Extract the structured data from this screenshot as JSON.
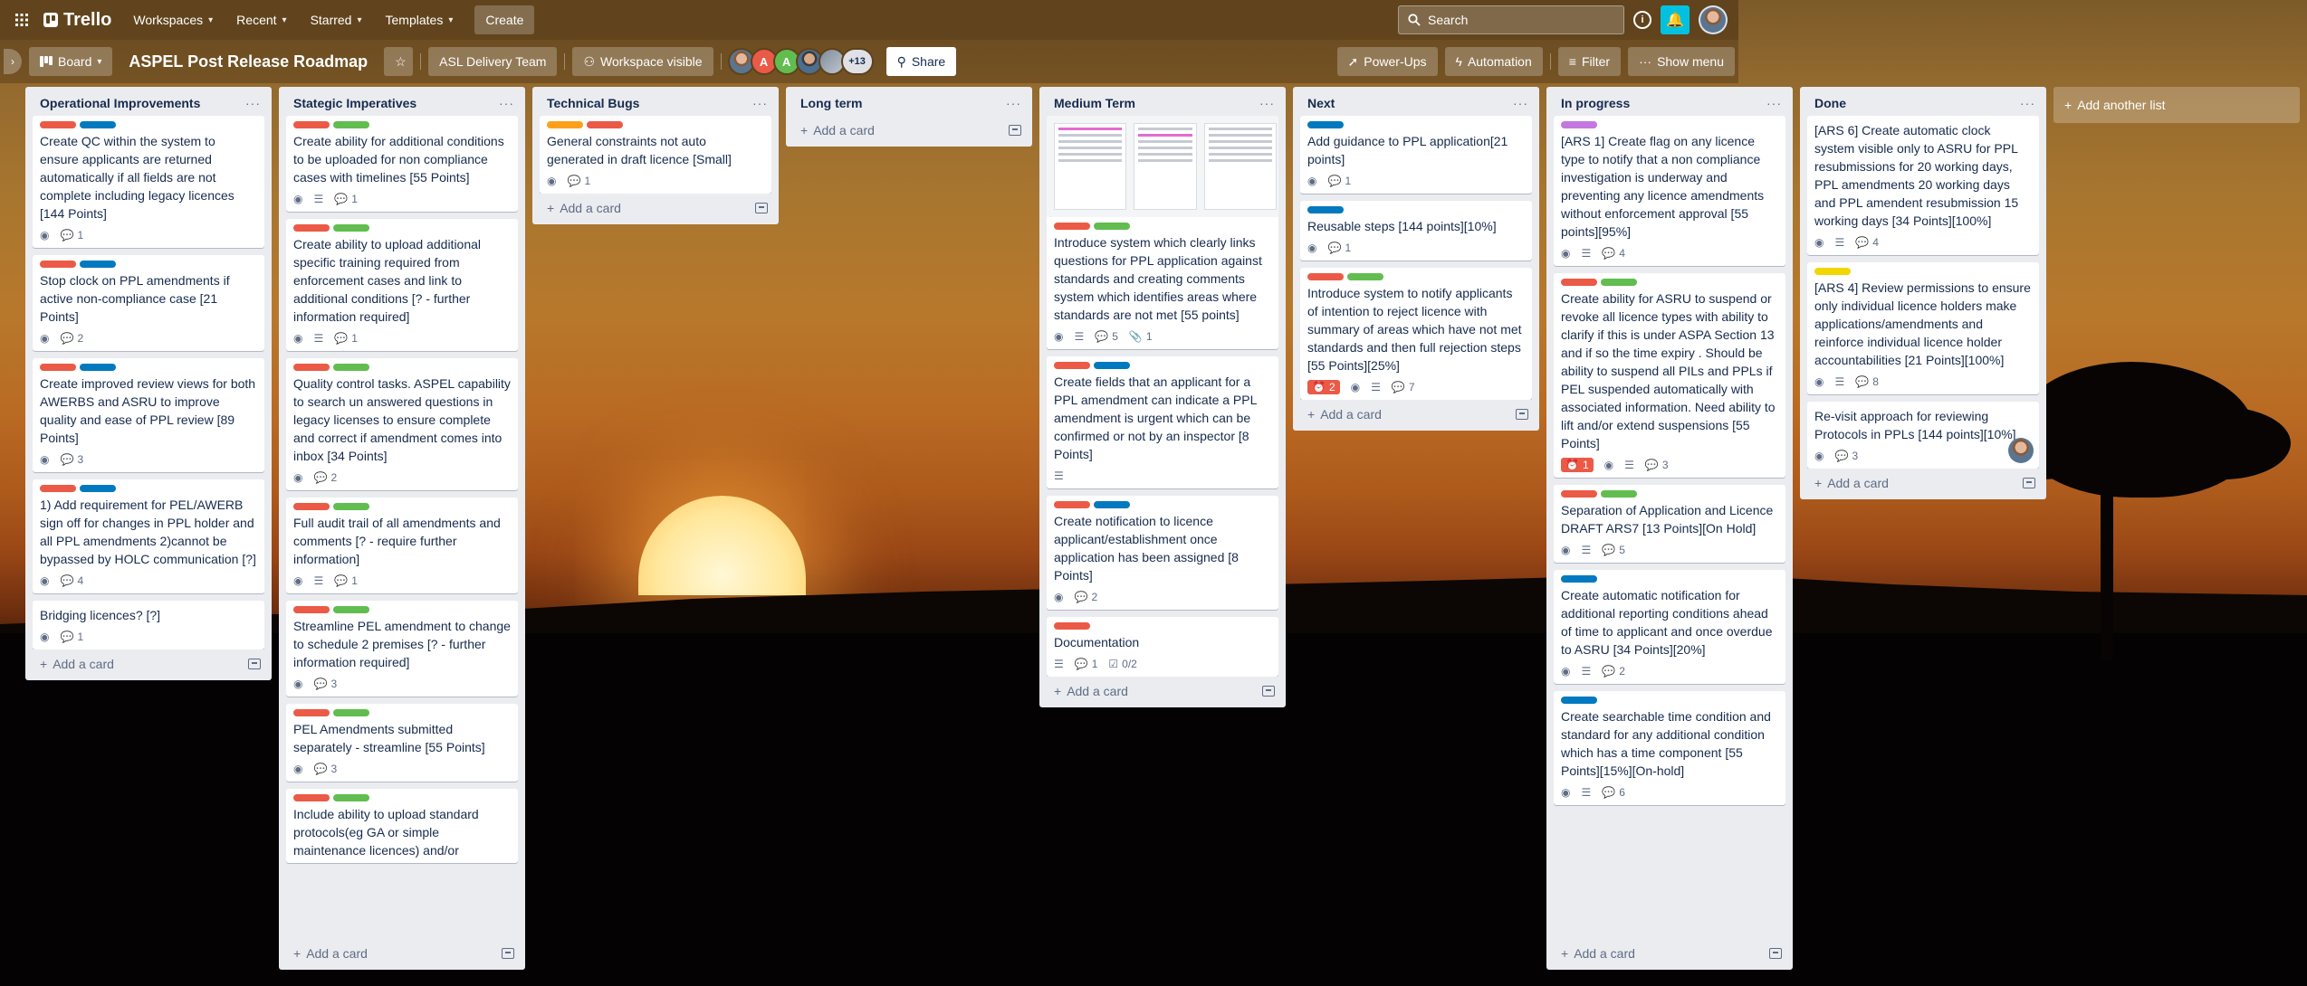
{
  "topbar": {
    "logo": "Trello",
    "nav": [
      {
        "label": "Workspaces"
      },
      {
        "label": "Recent"
      },
      {
        "label": "Starred"
      },
      {
        "label": "Templates"
      }
    ],
    "create_label": "Create",
    "search_placeholder": "Search",
    "info_glyph": "i",
    "bell_glyph": "🔔"
  },
  "board": {
    "view_label": "Board",
    "title": "ASPEL Post Release Roadmap",
    "star_glyph": "☆",
    "workspace_label": "ASL Delivery Team",
    "visibility_label": "Workspace visible",
    "members": [
      {
        "initial": "",
        "color": "#6b7f94"
      },
      {
        "initial": "A",
        "color": "#eb5a46"
      },
      {
        "initial": "A",
        "color": "#61bd4f"
      },
      {
        "initial": "",
        "color": "#4b6f8f"
      },
      {
        "initial": "",
        "color": "#7d8b99"
      }
    ],
    "more_members": "+13",
    "share_label": "Share",
    "powerups_label": "Power-Ups",
    "automation_label": "Automation",
    "filter_label": "Filter",
    "menu_label": "Show menu"
  },
  "colors": {
    "red": "#eb5a46",
    "green": "#61bd4f",
    "blue": "#0079bf",
    "orange": "#ff9f1a",
    "yellow": "#f2d600",
    "purple": "#c377e0"
  },
  "lists": [
    {
      "title": "Operational Improvements",
      "add_label": "Add a card",
      "cards": [
        {
          "labels": [
            "red",
            "blue"
          ],
          "title": "Create QC within the system to ensure applicants are returned automatically if all fields are not complete including legacy licences [144 Points]",
          "badges": {
            "watch": true,
            "comments": "1"
          }
        },
        {
          "labels": [
            "red",
            "blue"
          ],
          "title": "Stop clock on PPL amendments if active non-compliance case [21 Points]",
          "badges": {
            "watch": true,
            "comments": "2"
          }
        },
        {
          "labels": [
            "red",
            "blue"
          ],
          "title": "Create improved review views for both AWERBS and ASRU to improve quality and ease of PPL review [89 Points]",
          "badges": {
            "watch": true,
            "comments": "3"
          }
        },
        {
          "labels": [
            "red",
            "blue"
          ],
          "title": "1) Add requirement for PEL/AWERB sign off for changes in PPL holder and all PPL amendments 2)cannot be bypassed by HOLC communication [?]",
          "badges": {
            "watch": true,
            "comments": "4"
          }
        },
        {
          "labels": [],
          "title": "Bridging licences? [?]",
          "badges": {
            "watch": true,
            "comments": "1"
          }
        }
      ]
    },
    {
      "title": "Stategic Imperatives",
      "add_label": "Add a card",
      "cards": [
        {
          "labels": [
            "red",
            "green"
          ],
          "title": "Create ability for additional conditions to be uploaded for non compliance cases with timelines [55 Points]",
          "badges": {
            "watch": true,
            "desc": true,
            "comments": "1"
          }
        },
        {
          "labels": [
            "red",
            "green"
          ],
          "title": "Create ability to upload additional specific training required from enforcement cases and link to additional conditions [? - further information required]",
          "badges": {
            "watch": true,
            "desc": true,
            "comments": "1"
          }
        },
        {
          "labels": [
            "red",
            "green"
          ],
          "title": "Quality control tasks. ASPEL capability to search un answered questions in legacy licenses to ensure complete and correct if amendment comes into inbox [34 Points]",
          "badges": {
            "watch": true,
            "comments": "2"
          }
        },
        {
          "labels": [
            "red",
            "green"
          ],
          "title": "Full audit trail of all amendments and comments [? - require further information]",
          "badges": {
            "watch": true,
            "desc": true,
            "comments": "1"
          }
        },
        {
          "labels": [
            "red",
            "green"
          ],
          "title": "Streamline PEL amendment to change to schedule 2 premises [? - further information required]",
          "badges": {
            "watch": true,
            "comments": "3"
          }
        },
        {
          "labels": [
            "red",
            "green"
          ],
          "title": "PEL Amendments submitted separately - streamline [55 Points]",
          "badges": {
            "watch": true,
            "comments": "3"
          }
        },
        {
          "labels": [
            "red",
            "green"
          ],
          "title": "Include ability to upload standard protocols(eg GA or simple maintenance licences) and/or",
          "badges": {}
        }
      ]
    },
    {
      "title": "Technical Bugs",
      "add_label": "Add a card",
      "cards": [
        {
          "labels": [
            "orange",
            "red"
          ],
          "title": "General constraints not auto generated in draft licence [Small]",
          "badges": {
            "watch": true,
            "comments": "1"
          }
        }
      ]
    },
    {
      "title": "Long term",
      "add_label": "Add a card",
      "cards": []
    },
    {
      "title": "Medium Term",
      "add_label": "Add a card",
      "cards": [
        {
          "cover": true,
          "labels": [
            "red",
            "green"
          ],
          "title": "Introduce system which clearly links questions for PPL application against standards and creating comments system which identifies areas where standards are not met [55 points]",
          "badges": {
            "watch": true,
            "desc": true,
            "comments": "5",
            "attachments": "1"
          }
        },
        {
          "labels": [
            "red",
            "blue"
          ],
          "title": "Create fields that an applicant for a PPL amendment can indicate a PPL amendment is urgent which can be confirmed or not by an inspector [8 Points]",
          "badges": {
            "desc": true
          }
        },
        {
          "labels": [
            "red",
            "blue"
          ],
          "title": "Create notification to licence applicant/establishment once application has been assigned [8 Points]",
          "badges": {
            "watch": true,
            "comments": "2"
          }
        },
        {
          "labels": [
            "red"
          ],
          "title": "Documentation",
          "badges": {
            "desc": true,
            "comments": "1",
            "checklist": "0/2"
          }
        }
      ]
    },
    {
      "title": "Next",
      "add_label": "Add a card",
      "cards": [
        {
          "labels": [
            "blue"
          ],
          "title": "Add guidance to PPL application[21 points]",
          "badges": {
            "watch": true,
            "comments": "1"
          }
        },
        {
          "labels": [
            "blue"
          ],
          "title": "Reusable steps [144 points][10%]",
          "badges": {
            "watch": true,
            "comments": "1"
          }
        },
        {
          "labels": [
            "red",
            "green"
          ],
          "title": "Introduce system to notify applicants of intention to reject licence with summary of areas which have not met standards and then full rejection steps [55 Points][25%]",
          "badges": {
            "alert": "2",
            "watch": true,
            "desc": true,
            "comments": "7"
          }
        }
      ]
    },
    {
      "title": "In progress",
      "add_label": "Add a card",
      "cards": [
        {
          "labels": [
            "purple"
          ],
          "title": "[ARS 1] Create flag on any licence type to notify that a non compliance investigation is underway and preventing any licence amendments without enforcement approval [55 points][95%]",
          "badges": {
            "watch": true,
            "desc": true,
            "comments": "4"
          }
        },
        {
          "labels": [
            "red",
            "green"
          ],
          "title": "Create ability for ASRU to suspend or revoke all licence types with ability to clarify if this is under ASPA Section 13 and if so the time expiry . Should be ability to suspend all PILs and PPLs if PEL suspended automatically with associated information. Need ability to lift and/or extend suspensions [55 Points]",
          "badges": {
            "alert": "1",
            "watch": true,
            "desc": true,
            "comments": "3"
          }
        },
        {
          "labels": [
            "red",
            "green"
          ],
          "title": "Separation of Application and Licence DRAFT ARS7 [13 Points][On Hold]",
          "badges": {
            "watch": true,
            "desc": true,
            "comments": "5"
          }
        },
        {
          "labels": [
            "blue"
          ],
          "title": "Create automatic notification for additional reporting conditions ahead of time to applicant and once overdue to ASRU [34 Points][20%]",
          "badges": {
            "watch": true,
            "desc": true,
            "comments": "2"
          }
        },
        {
          "labels": [
            "blue"
          ],
          "title": "Create searchable time condition and standard for any additional condition which has a time component [55 Points][15%][On-hold]",
          "badges": {
            "watch": true,
            "desc": true,
            "comments": "6"
          }
        }
      ]
    },
    {
      "title": "Done",
      "add_label": "Add a card",
      "cards": [
        {
          "labels": [],
          "title": "[ARS 6] Create automatic clock system visible only to ASRU for PPL resubmissions for 20 working days, PPL amendments 20 working days and PPL amendent resubmission 15 working days [34 Points][100%]",
          "badges": {
            "watch": true,
            "desc": true,
            "comments": "4"
          }
        },
        {
          "labels": [
            "yellow"
          ],
          "title": "[ARS 4] Review permissions to ensure only individual licence holders make applications/amendments and reinforce individual licence holder accountabilities [21 Points][100%]",
          "badges": {
            "watch": true,
            "desc": true,
            "comments": "8"
          }
        },
        {
          "labels": [],
          "title": "Re-visit approach for reviewing Protocols in PPLs [144 points][10%]",
          "badges": {
            "watch": true,
            "comments": "3"
          },
          "member": true
        }
      ]
    }
  ],
  "add_list_label": "Add another list"
}
